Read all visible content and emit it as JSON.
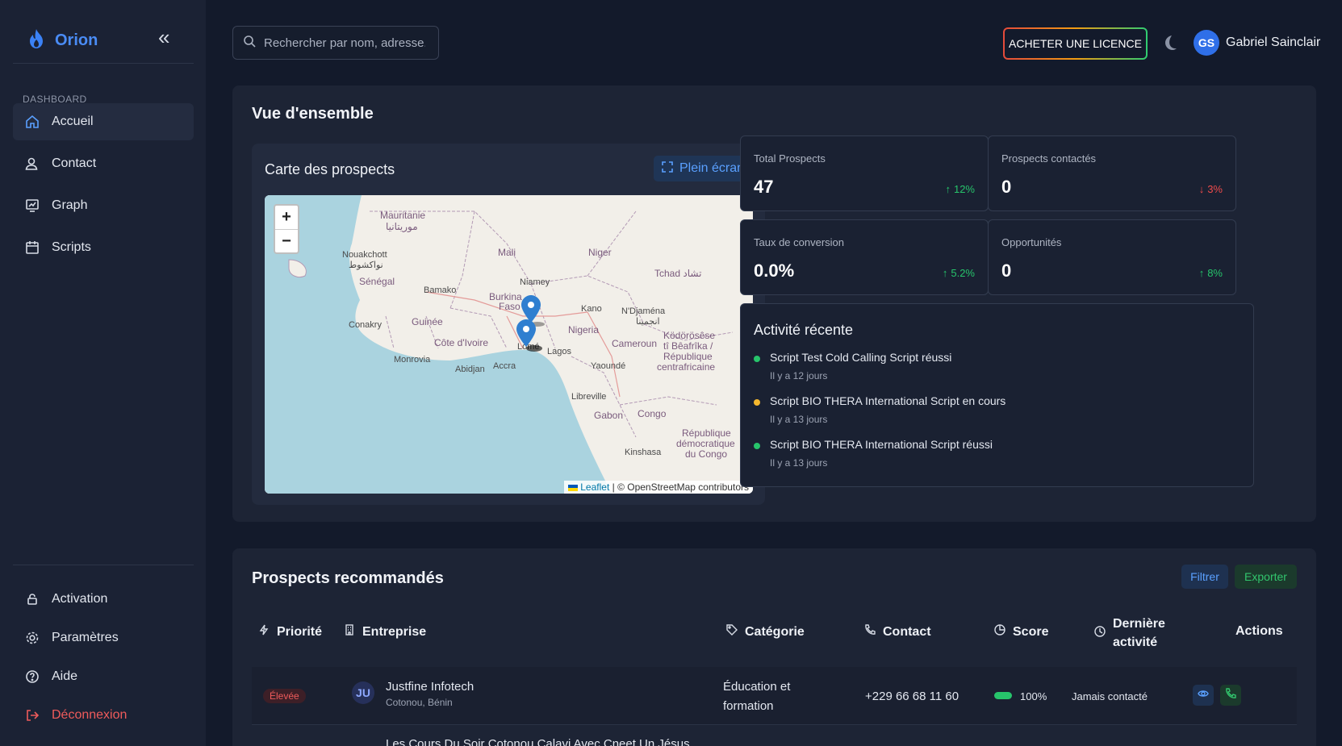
{
  "sidebar": {
    "brand": "Orion",
    "section_label": "DASHBOARD",
    "items": [
      {
        "label": "Accueil"
      },
      {
        "label": "Contact"
      },
      {
        "label": "Graph"
      },
      {
        "label": "Scripts"
      }
    ],
    "bottom_items": [
      {
        "label": "Activation"
      },
      {
        "label": "Paramètres"
      },
      {
        "label": "Aide"
      },
      {
        "label": "Déconnexion"
      }
    ]
  },
  "topbar": {
    "search_placeholder": "Rechercher par nom, adresse...",
    "license_label": "ACHETER UNE LICENCE",
    "user_initials": "GS",
    "user_name": "Gabriel Sainclair"
  },
  "overview": {
    "title": "Vue d'ensemble",
    "map": {
      "title": "Carte des prospects",
      "fullscreen_label": "Plein écran",
      "zoom_in": "+",
      "zoom_out": "−",
      "attribution_leaflet": "Leaflet",
      "attribution_rest": " | © OpenStreetMap contributors",
      "labels": {
        "mauritanie": "Mauritanie",
        "mauritanie_ar": "موريتانيا",
        "nouakchott": "Nouakchott",
        "nouakchott_ar": "نواكشوط",
        "senegal": "Sénégal",
        "mali": "Mali",
        "niger": "Niger",
        "tchad": "Tchad تشاد",
        "bamako": "Bamako",
        "burkina": "Burkina",
        "faso": "Faso",
        "niamey": "Niamey",
        "kano": "Kano",
        "ndjamena": "N'Djaména",
        "ndjamena_ar": "انجمينا",
        "conakry": "Conakry",
        "guinee": "Guinée",
        "nigeria": "Nigeria",
        "cote": "Côte d'Ivoire",
        "lome": "Lomé",
        "lagos": "Lagos",
        "cameroun": "Cameroun",
        "monrovia": "Monrovia",
        "abidjan": "Abidjan",
        "accra": "Accra",
        "yaounde": "Yaoundé",
        "kodorosese": "Ködörösêse",
        "beafrika": "tî Bêafrîka /",
        "republique": "République",
        "centrafricaine": "centrafricaine",
        "libreville": "Libreville",
        "gabon": "Gabon",
        "congo": "Congo",
        "rep_dem1": "République",
        "rep_dem2": "démocratique",
        "rep_dem3": "du Congo",
        "kinshasa": "Kinshasa"
      }
    },
    "stats": [
      {
        "label": "Total Prospects",
        "value": "47",
        "trend": "12%",
        "direction": "up"
      },
      {
        "label": "Prospects contactés",
        "value": "0",
        "trend": "3%",
        "direction": "down"
      },
      {
        "label": "Taux de conversion",
        "value": "0.0%",
        "trend": "5.2%",
        "direction": "up"
      },
      {
        "label": "Opportunités",
        "value": "0",
        "trend": "8%",
        "direction": "up"
      }
    ],
    "activity": {
      "title": "Activité récente",
      "items": [
        {
          "text": "Script Test Cold Calling Script réussi",
          "time": "Il y a 12 jours",
          "color": "#27c46b"
        },
        {
          "text": "Script BIO THERA International Script en cours",
          "time": "Il y a 13 jours",
          "color": "#f5b82e"
        },
        {
          "text": "Script BIO THERA International Script réussi",
          "time": "Il y a 13 jours",
          "color": "#27c46b"
        }
      ]
    }
  },
  "prospects": {
    "title": "Prospects recommandés",
    "filter_label": "Filtrer",
    "export_label": "Exporter",
    "columns": {
      "priority": "Priorité",
      "company": "Entreprise",
      "category": "Catégorie",
      "contact": "Contact",
      "score": "Score",
      "last_activity_1": "Dernière",
      "last_activity_2": "activité",
      "actions": "Actions"
    },
    "rows": [
      {
        "priority": "Élevée",
        "initials": "JU",
        "company": "Justfine Infotech",
        "location": "Cotonou, Bénin",
        "category_1": "Éducation et",
        "category_2": "formation",
        "phone": "+229 66 68 11 60",
        "score": "100%",
        "last_activity": "Jamais contacté"
      }
    ],
    "next_row_partial": "Les Cours Du Soir Cotonou Calavi Avec Cneet Un Jésus"
  }
}
